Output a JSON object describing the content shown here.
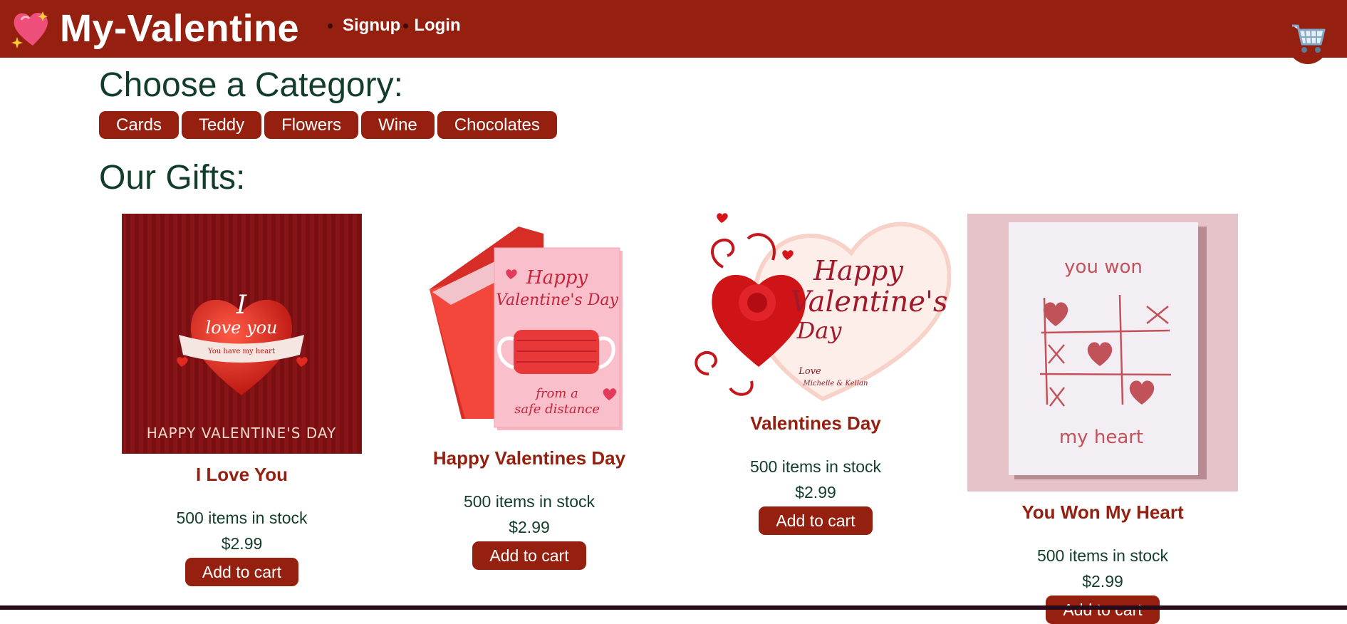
{
  "header": {
    "logo_icon": "sparkling-heart-icon",
    "title": "My-Valentine",
    "nav": [
      {
        "label": "Signup"
      },
      {
        "label": "Login"
      }
    ],
    "cart_icon": "shopping-cart-icon"
  },
  "categories": {
    "heading": "Choose a Category:",
    "items": [
      "Cards",
      "Teddy",
      "Flowers",
      "Wine",
      "Chocolates"
    ]
  },
  "gifts": {
    "heading": "Our Gifts:",
    "products": [
      {
        "name": "I Love You",
        "stock": "500 items in stock",
        "price": "$2.99",
        "button": "Add to cart",
        "image_text": {
          "line1": "I",
          "line2": "love you",
          "line3": "You have my heart",
          "footer": "HAPPY VALENTINE'S DAY"
        }
      },
      {
        "name": "Happy Valentines Day",
        "stock": "500 items in stock",
        "price": "$2.99",
        "button": "Add to cart",
        "image_text": {
          "line1": "Happy",
          "line2": "Valentine's Day",
          "line3": "from a",
          "line4": "safe distance"
        }
      },
      {
        "name": "Valentines Day",
        "stock": "500 items in stock",
        "price": "$2.99",
        "button": "Add to cart",
        "image_text": {
          "line1": "Happy",
          "line2": "Valentine's",
          "line3": "Day",
          "line4": "Love",
          "line5": "Michelle & Kellan"
        }
      },
      {
        "name": "You Won My Heart",
        "stock": "500 items in stock",
        "price": "$2.99",
        "button": "Add to cart",
        "image_text": {
          "line1": "you won",
          "line2": "my heart"
        }
      }
    ]
  },
  "colors": {
    "brand": "#962010",
    "heading_text": "#123d2a",
    "background": "#ffffff"
  }
}
